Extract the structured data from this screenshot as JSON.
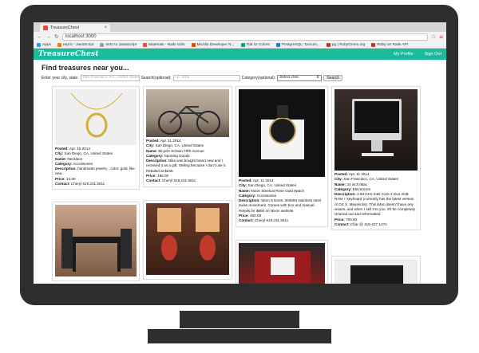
{
  "browser": {
    "tab_title": "TreasureChest",
    "url": "localhost:3000",
    "bookmarks": [
      "Apps",
      "repl.it - JavaScript",
      "Intro to JavaScript",
      "Materials - Rails Girls",
      "Mozilla Developer N...",
      "Flat UI Colors",
      "PostgreSQL: Docum...",
      "pg | RubyGems.org",
      "Ruby on Rails API"
    ]
  },
  "app": {
    "logo": "TreasureChest",
    "nav": {
      "profile": "My Profile",
      "signout": "Sign Out"
    }
  },
  "search": {
    "heading": "Find treasures near you...",
    "city_label": "Enter your city, state:",
    "city_placeholder": "San Francisco, CA, United States",
    "search_label": "Search(optional):",
    "search_placeholder": "i.e. Sofa",
    "category_label": "Category(optional):",
    "category_value": "Select One",
    "button": "Search"
  },
  "labels": {
    "posted": "Posted:",
    "city": "City:",
    "name": "Name:",
    "category": "Category:",
    "description": "Description:",
    "price": "Price:",
    "contact": "Contact:"
  },
  "listings": [
    {
      "posted": "Apr. 15 2014",
      "city": "San Diego, CA, United States",
      "name": "Necklace",
      "category": "Accessories",
      "description": "handmade jewelry , color: gold, like new..",
      "price": "14.00",
      "contact": "Cheryl 619.231.5611"
    },
    {
      "posted": "Apr. 11 2014",
      "city": "San Diego, CA, United States",
      "name": "Bicycle Schwin Fifth Avenue",
      "category": "Sporting Goods",
      "description": "Bike was bought brand new and I received it as a gift. Selling because I don't use it. Retailed at $240.",
      "price": "195.00",
      "contact": "Cheryl 619.231.5611"
    },
    {
      "posted": "Apr. 11 2014",
      "city": "San Diego, CA, United States",
      "name": "Nixon Steelcat Rose Gold Watch",
      "category": "Accessories",
      "description": "Worn 8 times. 300MM stainless steel swiss movement. Comes with box and manual. Retails for $650 on Nixon website.",
      "price": "400.00",
      "contact": "Cheryl 619.231.5611"
    },
    {
      "posted": "Apr. 11 2014",
      "city": "San Francisco, CA, United States",
      "name": "24 inch iMac",
      "category": "Electronics",
      "description": "2.93 GHz Intel Core 2 Duo 4GB RAM + keyboard (currently has the latest version of OS X, Mavericks). This iMac doesn't have any issues, and when I sell it to you, it'll be completely cleaned out and reformatted.",
      "price": "700.00",
      "contact": "Char @ 415-427-1374"
    }
  ]
}
